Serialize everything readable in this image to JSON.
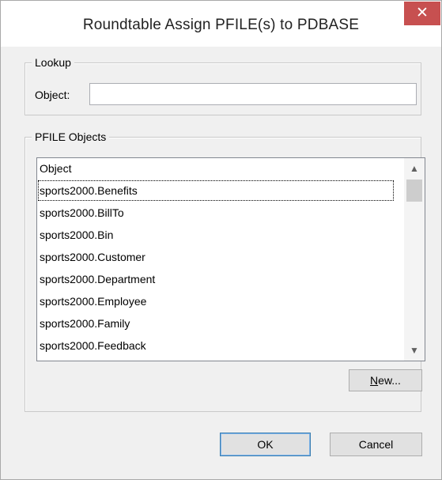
{
  "window": {
    "title": "Roundtable Assign PFILE(s) to PDBASE",
    "close_glyph": "✕"
  },
  "lookup": {
    "group_label": "Lookup",
    "object_label": "Object:",
    "object_value": ""
  },
  "pfile_objects": {
    "group_label": "PFILE Objects",
    "column_header": "Object",
    "items": [
      "sports2000.Benefits",
      "sports2000.BillTo",
      "sports2000.Bin",
      "sports2000.Customer",
      "sports2000.Department",
      "sports2000.Employee",
      "sports2000.Family",
      "sports2000.Feedback"
    ],
    "selected_index": 0,
    "new_button": {
      "key": "N",
      "rest": "ew..."
    }
  },
  "buttons": {
    "ok": "OK",
    "cancel": "Cancel"
  },
  "icons": {
    "scroll_up": "chevron-up-icon",
    "scroll_down": "chevron-down-icon",
    "close": "close-icon"
  }
}
